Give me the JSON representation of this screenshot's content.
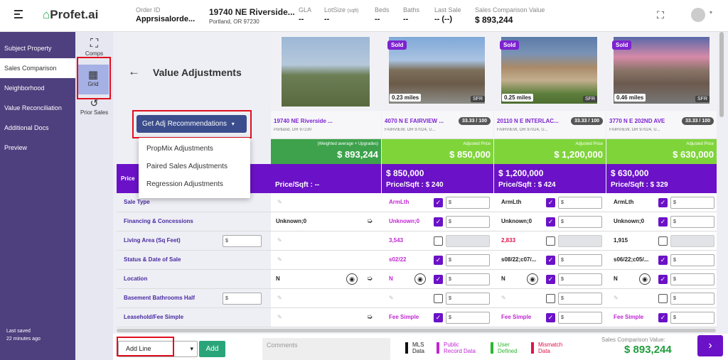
{
  "logo": {
    "text": "Profet.ai"
  },
  "header": {
    "order": {
      "label": "Order ID",
      "value": "Apprsisalorde..."
    },
    "address": {
      "line1": "19740 NE Riverside...",
      "line2": "Portland, OR 97230"
    },
    "gla": {
      "label": "GLA",
      "value": "--"
    },
    "lotsize": {
      "label": "LotSize",
      "unit": "(sqft)",
      "value": "--"
    },
    "beds": {
      "label": "Beds",
      "value": "--"
    },
    "baths": {
      "label": "Baths",
      "value": "--"
    },
    "lastsale": {
      "label": "Last Sale",
      "value": "-- (--)"
    },
    "scv": {
      "label": "Sales Comparison Value",
      "value": "$ 893,244"
    }
  },
  "nav": [
    "Subject Property",
    "Sales Comparison",
    "Neighborhood",
    "Value Reconciliation",
    "Additional Docs",
    "Preview"
  ],
  "last_saved": {
    "label": "Last saved",
    "value": "22 minutes ago"
  },
  "mini": {
    "comps": "Comps",
    "grid": "Grid",
    "prior": "Prior Sales"
  },
  "page_title": "Value Adjustments",
  "rec_button": "Get Adj Recommendations",
  "dropdown": [
    "PropMix Adjustments",
    "Paired Sales Adjustments",
    "Regression Adjustments"
  ],
  "subject": {
    "addr1": "19740 NE Riverside ...",
    "addr2": "Portland, OR 97230",
    "weighted_label": "(Weighted average + Upgrades)",
    "weighted_value": "$ 893,244",
    "ppsf": "Price/Sqft : --",
    "price_label": "Price"
  },
  "comps": [
    {
      "sold": "Sold",
      "miles": "0.23 miles",
      "type": "SFR",
      "addr1": "4070 N E FAIRVIEW ...",
      "addr2": "FAIRVIEW, OR 97024, U...",
      "score": "33.33 / 100",
      "adj_label": "Adjusted Price",
      "adj": "$ 850,000",
      "price": "$ 850,000",
      "ppsf": "Price/Sqft : $ 240"
    },
    {
      "sold": "Sold",
      "miles": "0.25 miles",
      "type": "SFR",
      "addr1": "20110 N E INTERLAC...",
      "addr2": "FAIRVIEW, OR 97024, U...",
      "score": "33.33 / 100",
      "adj_label": "Adjusted Price",
      "adj": "$ 1,200,000",
      "price": "$ 1,200,000",
      "ppsf": "Price/Sqft : $ 424"
    },
    {
      "sold": "Sold",
      "miles": "0.46 miles",
      "type": "SFR",
      "addr1": "3770 N E 202ND AVE",
      "addr2": "FAIRVIEW, OR 97024, U...",
      "score": "33.33 / 100",
      "adj_label": "Adjusted Price",
      "adj": "$ 630,000",
      "price": "$ 630,000",
      "ppsf": "Price/Sqft : $ 329"
    }
  ],
  "rows": [
    {
      "label": "Sale Type",
      "subject": "",
      "c": [
        "ArmLth",
        "ArmLth",
        "ArmLth"
      ]
    },
    {
      "label": "Financing & Concessions",
      "subject": "Unknown;0",
      "c": [
        "Unknown;0",
        "Unknown;0",
        "Unknown;0"
      ]
    },
    {
      "label": "Living Area (Sq Feet)",
      "subject": "",
      "c": [
        "3,543",
        "2,833",
        "1,915"
      ]
    },
    {
      "label": "Status & Date of Sale",
      "subject": "",
      "c": [
        "s02/22",
        "s08/22;c07/...",
        "s06/22;c05/..."
      ]
    },
    {
      "label": "Location",
      "subject": "N",
      "c": [
        "N",
        "N",
        "N"
      ]
    },
    {
      "label": "Basement Bathrooms Half",
      "subject": "",
      "c": [
        "",
        "",
        ""
      ]
    },
    {
      "label": "Leasehold/Fee Simple",
      "subject": "",
      "c": [
        "Fee Simple",
        "Fee Simple",
        "Fee Simple"
      ]
    }
  ],
  "dollar": "$",
  "bottom": {
    "addline": "Add Line",
    "add": "Add",
    "comments": "Comments",
    "mls1": "MLS",
    "mls2": "Data",
    "pub1": "Public",
    "pub2": "Record Data",
    "usr1": "User",
    "usr2": "Defined",
    "mis1": "Mismatch",
    "mis2": "Data",
    "scv_label": "Sales Comparison Value:",
    "scv_value": "$ 893,244"
  },
  "colors": {
    "purple": "#6b11c7",
    "nav": "#4e3f7e",
    "green": "#7fd43a",
    "green_dark": "#3da24b",
    "red": "#e0124b"
  }
}
